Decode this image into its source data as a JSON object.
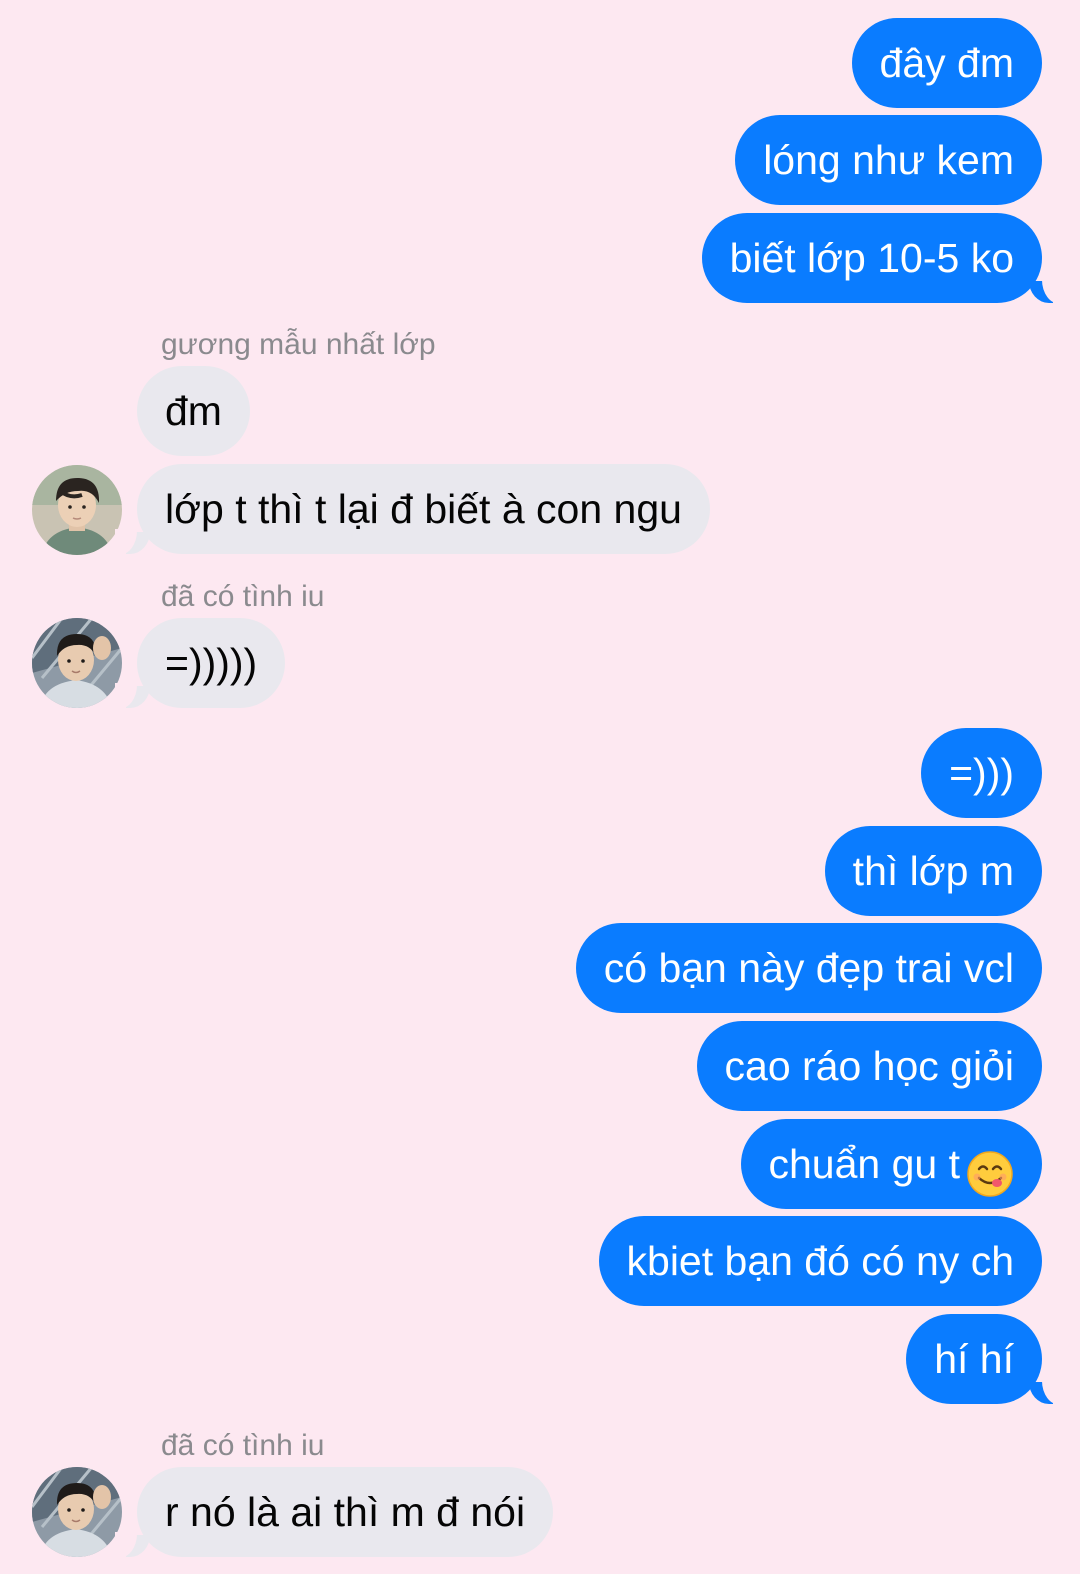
{
  "theme": {
    "background": "#fde8f1",
    "outgoing_bubble": "#0a7cff",
    "incoming_bubble": "#e9e8ee",
    "sender_name_color": "#8a8a8e"
  },
  "messages": [
    {
      "direction": "outgoing",
      "text": "đây đm"
    },
    {
      "direction": "outgoing",
      "text": "lóng như kem"
    },
    {
      "direction": "outgoing",
      "text": "biết lớp 10-5 ko"
    },
    {
      "direction": "incoming",
      "sender": "gương mẫu nhất lớp",
      "text": "đm"
    },
    {
      "direction": "incoming",
      "sender": "gương mẫu nhất lớp",
      "text": "lớp t thì t lại đ biết à con ngu"
    },
    {
      "direction": "incoming",
      "sender": "đã có tình iu",
      "text": "=)))))"
    },
    {
      "direction": "outgoing",
      "text": "=)))"
    },
    {
      "direction": "outgoing",
      "text": "thì lớp m"
    },
    {
      "direction": "outgoing",
      "text": "có bạn này đẹp trai vcl"
    },
    {
      "direction": "outgoing",
      "text": "cao ráo học giỏi"
    },
    {
      "direction": "outgoing",
      "text": "chuẩn gu t",
      "emoji": "yum-face-emoji"
    },
    {
      "direction": "outgoing",
      "text": "kbiet bạn đó có ny ch"
    },
    {
      "direction": "outgoing",
      "text": "hí hí"
    },
    {
      "direction": "incoming",
      "sender": "đã có tình iu",
      "text": "r nó là ai thì m đ nói"
    }
  ],
  "sender_labels": [
    "gương mẫu nhất lớp",
    "đã có tình iu",
    "đã có tình iu"
  ],
  "avatars": [
    {
      "icon": "avatar-photo-boy-1"
    },
    {
      "icon": "avatar-photo-boy-2"
    },
    {
      "icon": "avatar-photo-boy-2"
    }
  ]
}
